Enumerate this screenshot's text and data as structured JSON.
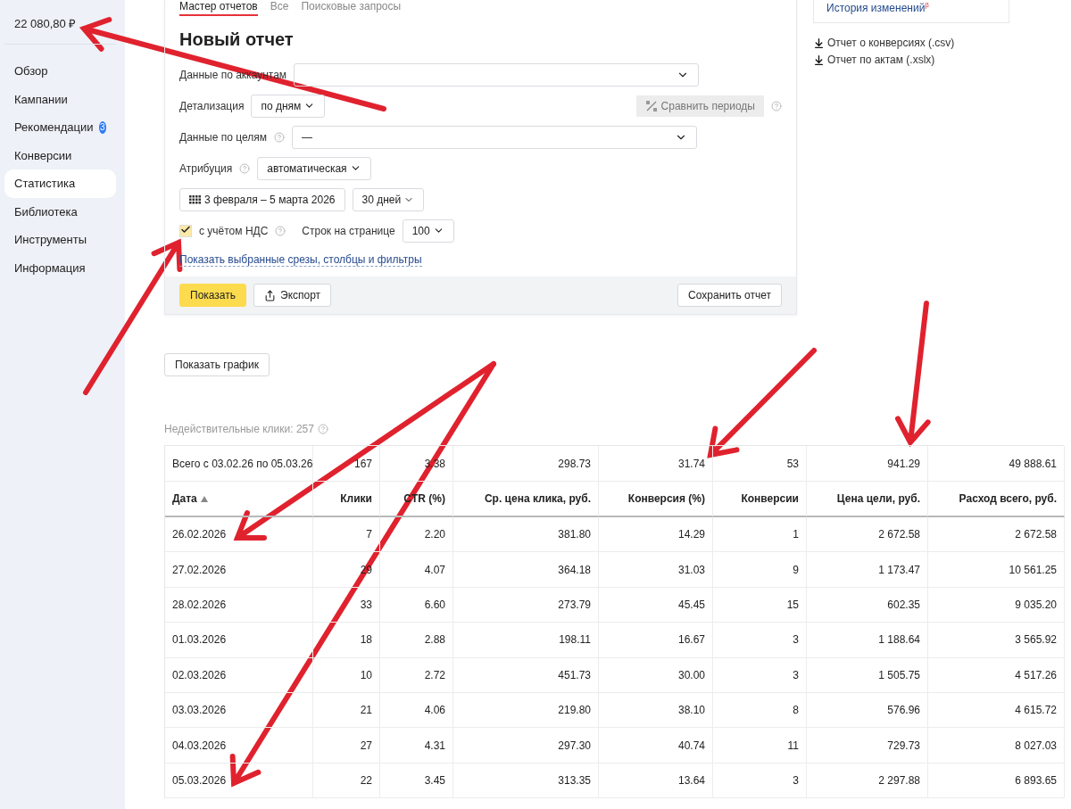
{
  "sidebar": {
    "balance": "22 080,80 ₽",
    "items": [
      {
        "label": "Обзор",
        "selected": false
      },
      {
        "label": "Кампании",
        "selected": false
      },
      {
        "label": "Рекомендации",
        "selected": false,
        "badge": "3"
      },
      {
        "label": "Конверсии",
        "selected": false
      },
      {
        "label": "Статистика",
        "selected": true
      },
      {
        "label": "Библиотека",
        "selected": false
      },
      {
        "label": "Инструменты",
        "selected": false
      },
      {
        "label": "Информация",
        "selected": false
      }
    ]
  },
  "tabs": [
    {
      "label": "Мастер отчетов",
      "selected": true
    },
    {
      "label": "Все",
      "selected": false
    },
    {
      "label": "Поисковые запросы",
      "selected": false
    }
  ],
  "report": {
    "title": "Новый отчет",
    "accounts": {
      "label": "Данные по аккаунтам"
    },
    "detail": {
      "label": "Детализация",
      "value": "по дням"
    },
    "compare_button": "Сравнить периоды",
    "goals": {
      "label": "Данные по целям",
      "value": "—"
    },
    "attribution": {
      "label": "Атрибуция",
      "value": "автоматическая"
    },
    "date_range": "3 февраля – 5 марта 2026",
    "period": "30 дней",
    "vat": {
      "label": "с учётом НДС",
      "checked": true
    },
    "rows_per_page": {
      "label": "Строк на странице",
      "value": "100"
    },
    "filters_link": "Показать выбранные срезы, столбцы и фильтры",
    "actions": {
      "show": "Показать",
      "export": "Экспорт",
      "save": "Сохранить отчет"
    }
  },
  "right_panel": {
    "history_link": "История изменений",
    "history_mark": "β",
    "downloads": [
      "Отчет о конверсиях (.csv)",
      "Отчет по актам (.xslx)"
    ]
  },
  "chart_button": "Показать график",
  "invalid_clicks": "Недействительные клики: 257",
  "table": {
    "totals": [
      "Всего с 03.02.26 по 05.03.26",
      "167",
      "3.38",
      "298.73",
      "31.74",
      "53",
      "941.29",
      "49 888.61"
    ],
    "columns": [
      {
        "label": "Дата",
        "sorted": true
      },
      {
        "label": "Клики",
        "sorted": false
      },
      {
        "label": "CTR (%)",
        "sorted": false
      },
      {
        "label": "Ср. цена клика, руб.",
        "sorted": false
      },
      {
        "label": "Конверсия (%)",
        "sorted": false
      },
      {
        "label": "Конверсии",
        "sorted": false
      },
      {
        "label": "Цена цели, руб.",
        "sorted": false
      },
      {
        "label": "Расход всего, руб.",
        "sorted": false
      }
    ],
    "rows": [
      [
        "26.02.2026",
        "7",
        "2.20",
        "381.80",
        "14.29",
        "1",
        "2 672.58",
        "2 672.58"
      ],
      [
        "27.02.2026",
        "29",
        "4.07",
        "364.18",
        "31.03",
        "9",
        "1 173.47",
        "10 561.25"
      ],
      [
        "28.02.2026",
        "33",
        "6.60",
        "273.79",
        "45.45",
        "15",
        "602.35",
        "9 035.20"
      ],
      [
        "01.03.2026",
        "18",
        "2.88",
        "198.11",
        "16.67",
        "3",
        "1 188.64",
        "3 565.92"
      ],
      [
        "02.03.2026",
        "10",
        "2.72",
        "451.73",
        "30.00",
        "3",
        "1 505.75",
        "4 517.26"
      ],
      [
        "03.03.2026",
        "21",
        "4.06",
        "219.80",
        "38.10",
        "8",
        "576.96",
        "4 615.72"
      ],
      [
        "04.03.2026",
        "27",
        "4.31",
        "297.30",
        "40.74",
        "11",
        "729.73",
        "8 027.03"
      ],
      [
        "05.03.2026",
        "22",
        "3.45",
        "313.35",
        "13.64",
        "3",
        "2 297.88",
        "6 893.65"
      ]
    ]
  }
}
